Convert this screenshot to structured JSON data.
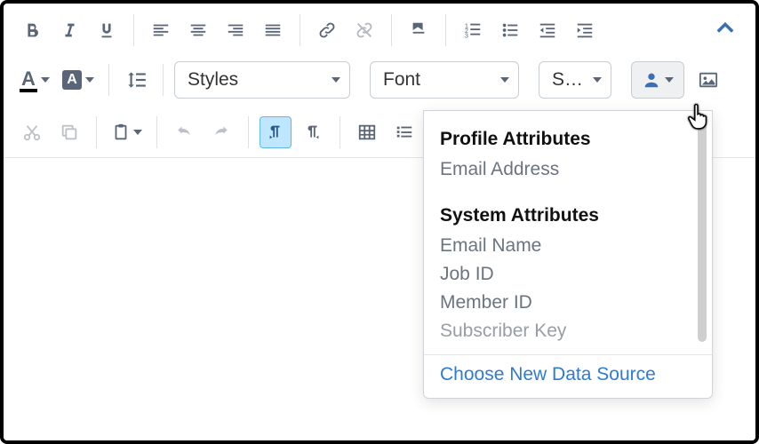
{
  "toolbar": {
    "styles_label": "Styles",
    "font_label": "Font",
    "size_label": "S…"
  },
  "dropdown": {
    "section1_header": "Profile Attributes",
    "section1_items": [
      "Email Address"
    ],
    "section2_header": "System Attributes",
    "section2_items": [
      "Email Name",
      "Job ID",
      "Member ID",
      "Subscriber Key"
    ],
    "footer": "Choose New Data Source"
  }
}
